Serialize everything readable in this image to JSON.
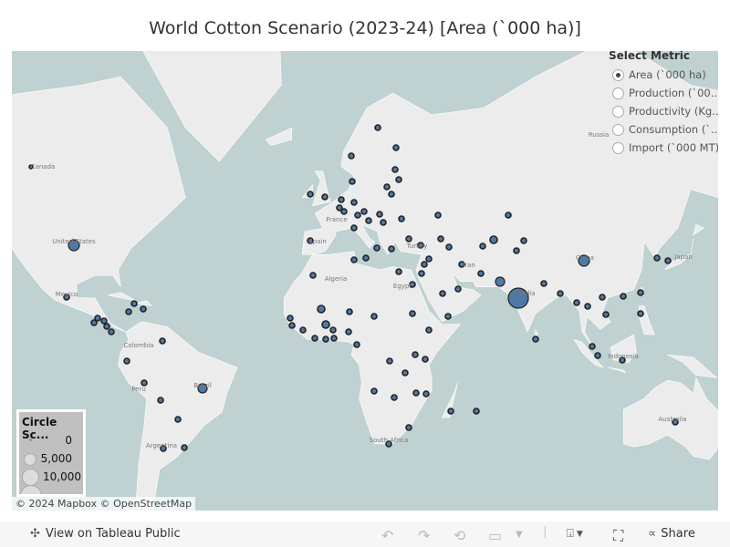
{
  "title": "World Cotton Scenario (2023-24) [Area (`000 ha)]",
  "metric_selector": {
    "heading": "Select Metric",
    "selected": 0,
    "options": [
      "Area (`000 ha)",
      "Production (`00...",
      "Productivity (Kg...",
      "Consumption (`...",
      "Import (`000 MT)"
    ]
  },
  "legend": {
    "title": "Circle Sc...",
    "items": [
      "0",
      "5,000",
      "10,000"
    ]
  },
  "country_labels": [
    "Canada",
    "United States",
    "Mexico",
    "Colombia",
    "Peru",
    "Brazil",
    "Argentina",
    "France",
    "Spain",
    "Algeria",
    "Egypt",
    "Turkey",
    "Iran",
    "India",
    "China",
    "Japan",
    "Indonesia",
    "Australia",
    "Russia",
    "South Africa"
  ],
  "attribution": "© 2024 Mapbox  © OpenStreetMap",
  "toolbar": {
    "view_label": "View on Tableau Public",
    "share_label": "Share"
  },
  "colors": {
    "sea": "#bfd1d1",
    "land": "#ececec",
    "marker": "#4e79a7"
  }
}
